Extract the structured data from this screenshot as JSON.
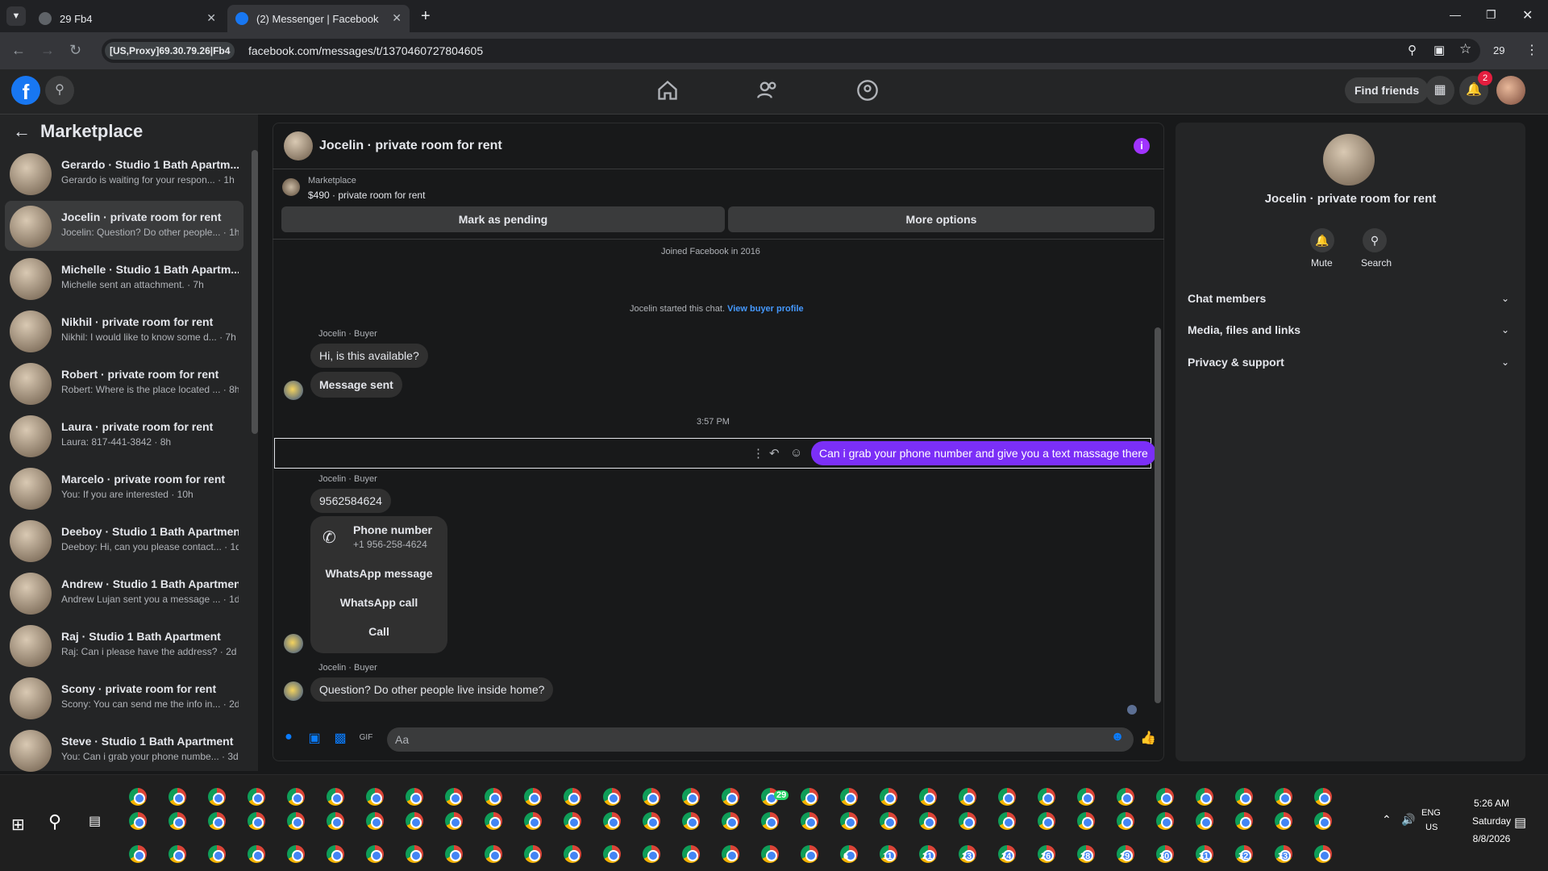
{
  "browser": {
    "tabs": [
      {
        "title": "29 Fb4"
      },
      {
        "title": "(2) Messenger | Facebook"
      }
    ],
    "proxy_label": "[US,Proxy]69.30.79.26|Fb4",
    "url": "facebook.com/messages/t/1370460727804605",
    "profile_count": "29"
  },
  "header": {
    "find_friends": "Find friends",
    "notif_count": "2"
  },
  "left": {
    "title": "Marketplace",
    "conversations": [
      {
        "name": "Gerardo · Studio 1 Bath Apartm...",
        "sub": "Gerardo is waiting for your respon... · 1h"
      },
      {
        "name": "Jocelin · private room for rent",
        "sub": "Jocelin: Question? Do other people... · 1h"
      },
      {
        "name": "Michelle · Studio 1 Bath Apartm...",
        "sub": "Michelle sent an attachment. · 7h"
      },
      {
        "name": "Nikhil · private room for rent",
        "sub": "Nikhil: I would like to know some d... · 7h"
      },
      {
        "name": "Robert · private room for rent",
        "sub": "Robert: Where is the place located ... · 8h"
      },
      {
        "name": "Laura · private room for rent",
        "sub": "Laura: 817-441-3842 · 8h"
      },
      {
        "name": "Marcelo · private room for rent",
        "sub": "You: If you are interested · 10h"
      },
      {
        "name": "Deeboy · Studio 1 Bath Apartment",
        "sub": "Deeboy: Hi, can you please contact... · 1d"
      },
      {
        "name": "Andrew · Studio 1 Bath Apartment",
        "sub": "Andrew Lujan sent you a message ... · 1d"
      },
      {
        "name": "Raj · Studio 1 Bath Apartment",
        "sub": "Raj: Can i please have the address? · 2d"
      },
      {
        "name": "Scony · private room for rent",
        "sub": "Scony: You can send me the info in... · 2d"
      },
      {
        "name": "Steve · Studio 1 Bath Apartment",
        "sub": "You: Can i grab your phone numbe... · 3d"
      }
    ]
  },
  "chat": {
    "title": "Jocelin · private room for rent",
    "marketplace_label": "Marketplace",
    "listing": "$490 · private room for rent",
    "mark_pending": "Mark as pending",
    "more_options": "More options",
    "joined": "Joined Facebook in 2016",
    "started": "Jocelin started this chat.",
    "view_profile": "View buyer profile",
    "sender_label": "Jocelin · Buyer",
    "msg1": "Hi, is this available?",
    "msg2": "Message sent",
    "time": "3:57 PM",
    "my_msg": "Can i grab your phone number and give  you a text massage there",
    "msg3": "9562584624",
    "phone_card": {
      "title": "Phone number",
      "number": "+1 956-258-4624",
      "opt1": "WhatsApp message",
      "opt2": "WhatsApp call",
      "opt3": "Call"
    },
    "msg4": "Question? Do other people live inside home?",
    "composer_placeholder": "Aa"
  },
  "right": {
    "title": "Jocelin · private room for rent",
    "mute": "Mute",
    "search": "Search",
    "sections": [
      "Chat members",
      "Media, files and links",
      "Privacy & support"
    ]
  },
  "taskbar": {
    "lang1": "ENG",
    "lang2": "US",
    "time": "5:26 AM",
    "day": "Saturday",
    "date": "8/8/2026",
    "whatsapp_count": "29",
    "numbered": [
      "6",
      "11",
      "21",
      "23",
      "24",
      "26",
      "28",
      "29",
      "30",
      "31",
      "32",
      "33"
    ]
  },
  "colors": {
    "accent": "#7b2ff7",
    "fb_blue": "#1877f2",
    "info": "#a033ff"
  }
}
